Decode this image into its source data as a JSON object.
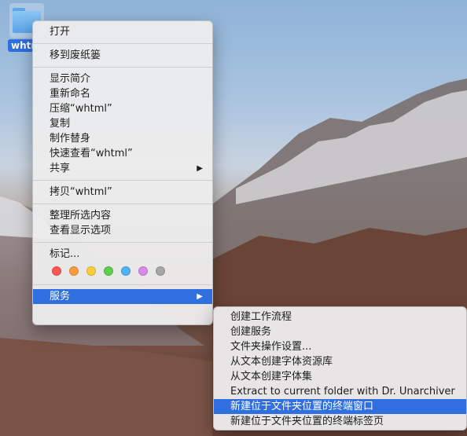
{
  "desktop": {
    "folder_name": "whtml"
  },
  "context_menu": {
    "groups": [
      [
        "打开"
      ],
      [
        "移到废纸篓"
      ],
      [
        "显示简介",
        "重新命名",
        "压缩“whtml”",
        "复制",
        "制作替身",
        "快速查看“whtml”",
        "共享"
      ],
      [
        "拷贝“whtml”"
      ],
      [
        "整理所选内容",
        "查看显示选项"
      ]
    ],
    "tags_label": "标记...",
    "tag_colors": [
      "#fc5753",
      "#fd9a3e",
      "#fdcd3b",
      "#5ed14c",
      "#4fb3f9",
      "#d78ae6",
      "#a7a7a7"
    ],
    "services_label": "服务"
  },
  "services_menu": {
    "items": [
      "创建工作流程",
      "创建服务",
      "文件夹操作设置...",
      "从文本创建字体资源库",
      "从文本创建字体集",
      "Extract to current folder with Dr. Unarchiver",
      "新建位于文件夹位置的终端窗口",
      "新建位于文件夹位置的终端标签页"
    ],
    "highlighted_index": 6
  },
  "colors": {
    "selection": "#2f6fdf",
    "menu_bg": "#ececec"
  }
}
